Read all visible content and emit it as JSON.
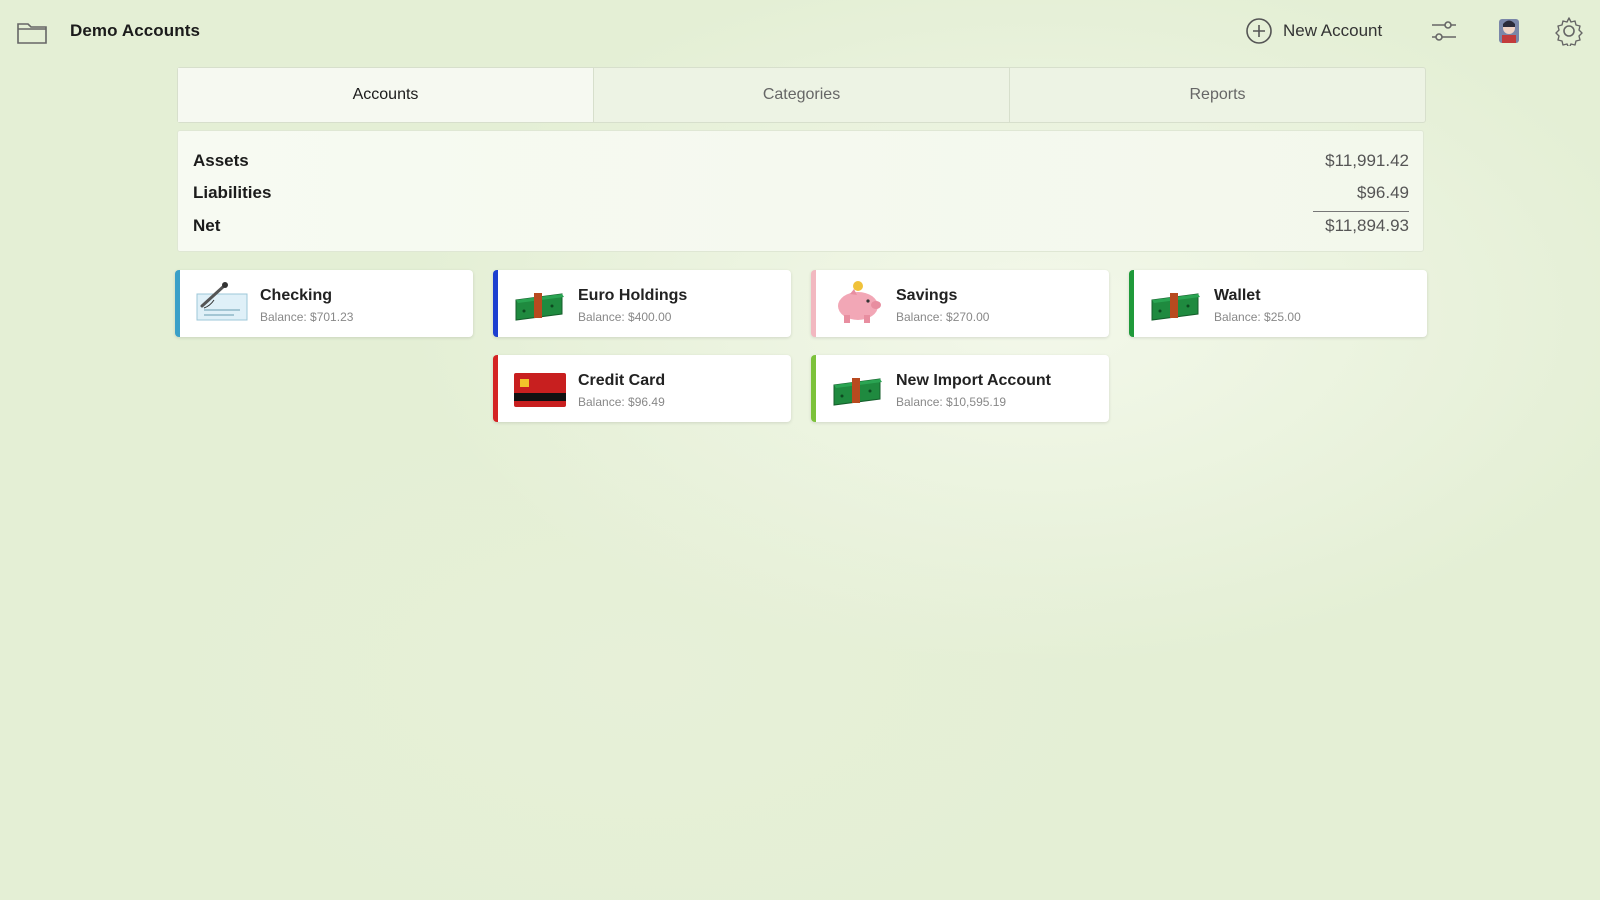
{
  "window": {
    "title": "Demo Accounts"
  },
  "toolbar": {
    "new_account_label": "New Account"
  },
  "tabs": [
    {
      "label": "Accounts",
      "active": true
    },
    {
      "label": "Categories",
      "active": false
    },
    {
      "label": "Reports",
      "active": false
    }
  ],
  "summary": {
    "assets": {
      "label": "Assets",
      "value": "$11,991.42"
    },
    "liabilities": {
      "label": "Liabilities",
      "value": "$96.49"
    },
    "net": {
      "label": "Net",
      "value": "$11,894.93"
    }
  },
  "accounts": [
    {
      "name": "Checking",
      "balance": "Balance: $701.23",
      "icon": "check-pen-icon",
      "color": "#3aa0c8"
    },
    {
      "name": "Euro Holdings",
      "balance": "Balance: $400.00",
      "icon": "cash-stack-icon",
      "color": "#1c3fd0"
    },
    {
      "name": "Savings",
      "balance": "Balance: $270.00",
      "icon": "piggy-bank-icon",
      "color": "#f2b8c0"
    },
    {
      "name": "Wallet",
      "balance": "Balance: $25.00",
      "icon": "cash-stack-icon",
      "color": "#1f9a3a"
    },
    {
      "name": "Credit Card",
      "balance": "Balance: $96.49",
      "icon": "credit-card-icon",
      "color": "#d42323"
    },
    {
      "name": "New Import Account",
      "balance": "Balance: $10,595.19",
      "icon": "cash-stack-icon",
      "color": "#7cc23a"
    }
  ]
}
